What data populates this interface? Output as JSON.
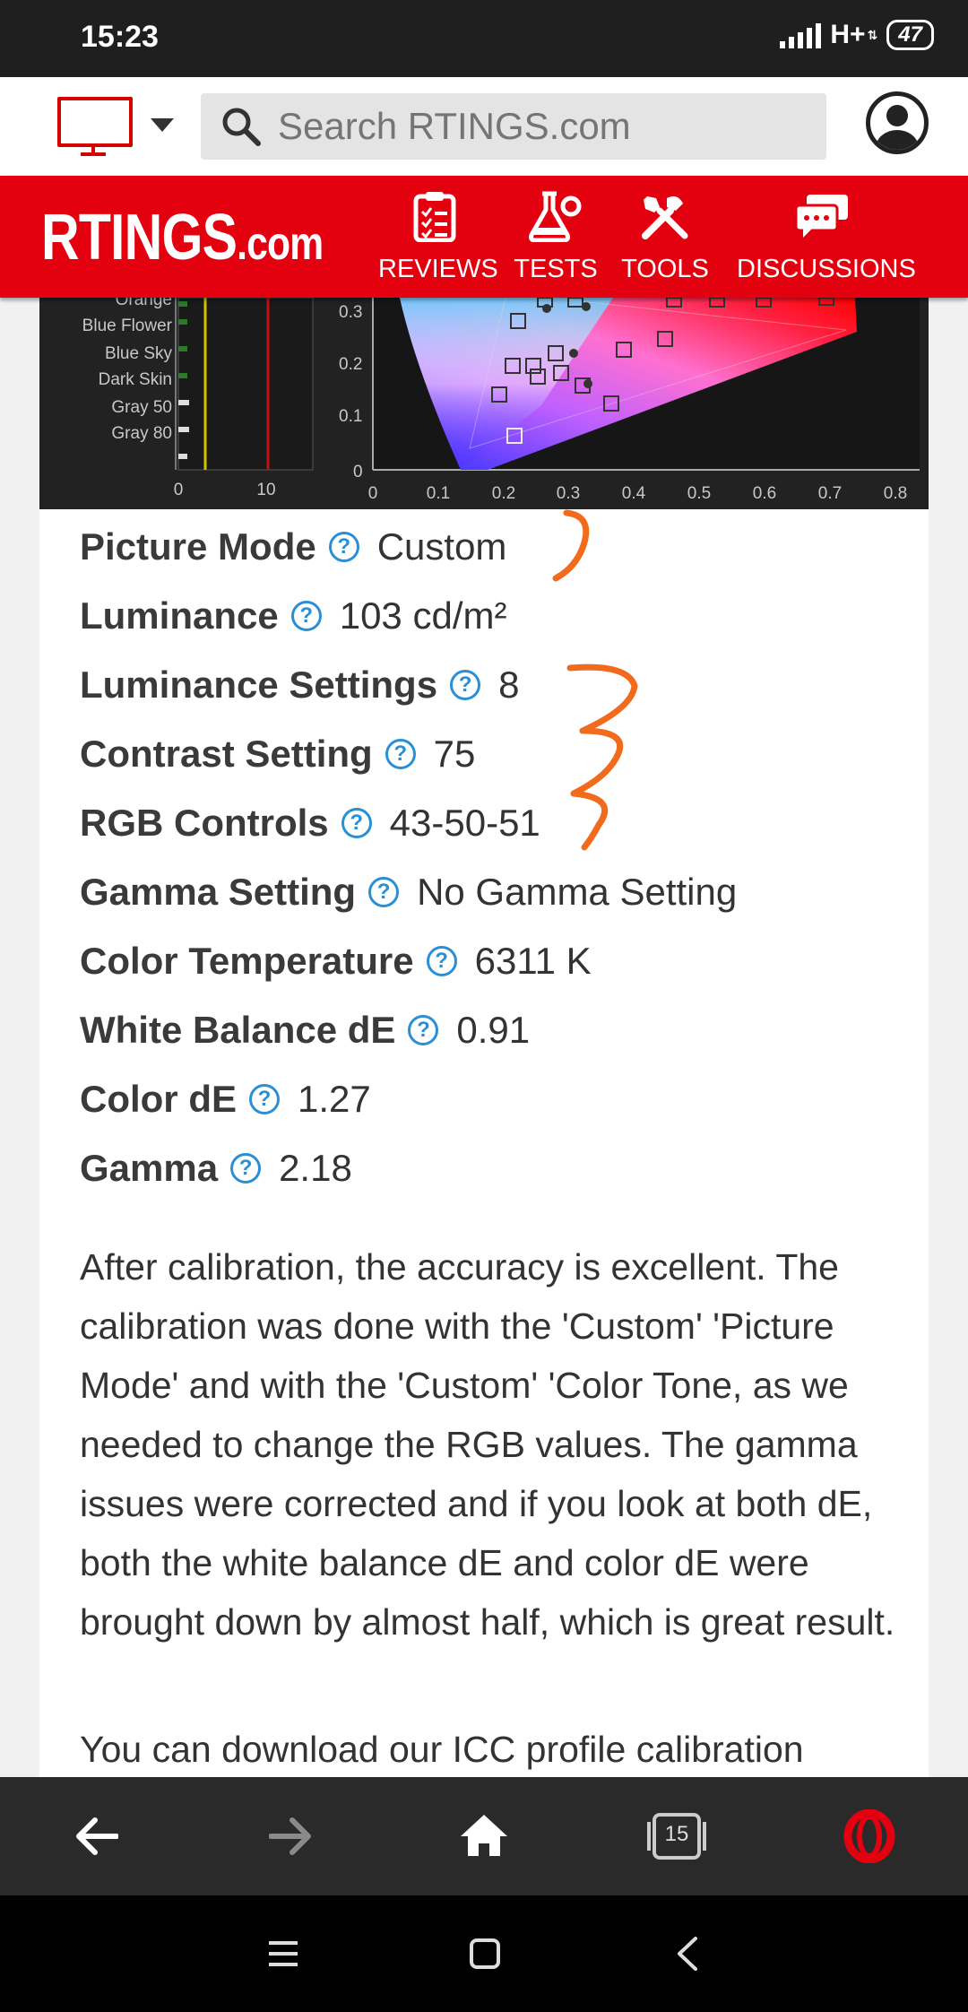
{
  "status": {
    "time": "15:23",
    "network": "H+",
    "battery": "47"
  },
  "search": {
    "placeholder": "Search RTINGS.com"
  },
  "header": {
    "logo_main": "RTINGS",
    "logo_suffix": ".com",
    "nav": [
      {
        "label": "REVIEWS",
        "icon": "clipboard-icon"
      },
      {
        "label": "TESTS",
        "icon": "flask-icon"
      },
      {
        "label": "TOOLS",
        "icon": "tools-icon"
      },
      {
        "label": "DISCUSSIONS",
        "icon": "chat-icon"
      }
    ]
  },
  "chart_left": {
    "labels": [
      "Orange",
      "Blue Flower",
      "Blue Sky",
      "Dark Skin",
      "Gray 50",
      "Gray 80"
    ],
    "xticks": [
      "0",
      "10"
    ]
  },
  "chart_right": {
    "yticks": [
      "0.3",
      "0.2",
      "0.1",
      "0"
    ],
    "xticks": [
      "0",
      "0.1",
      "0.2",
      "0.3",
      "0.4",
      "0.5",
      "0.6",
      "0.7",
      "0.8"
    ]
  },
  "specs": [
    {
      "label": "Picture Mode",
      "value": "Custom"
    },
    {
      "label": "Luminance",
      "value": "103 cd/m²"
    },
    {
      "label": "Luminance Settings",
      "value": "8"
    },
    {
      "label": "Contrast Setting",
      "value": "75"
    },
    {
      "label": "RGB Controls",
      "value": "43-50-51"
    },
    {
      "label": "Gamma Setting",
      "value": "No Gamma Setting"
    },
    {
      "label": "Color Temperature",
      "value": "6311 K"
    },
    {
      "label": "White Balance dE",
      "value": "0.91"
    },
    {
      "label": "Color dE",
      "value": "1.27"
    },
    {
      "label": "Gamma",
      "value": "2.18"
    }
  ],
  "help_glyph": "?",
  "paragraph": "After calibration, the accuracy is excellent. The calibration was done with the 'Custom' 'Picture Mode' and with the 'Custom' 'Color Tone, as we needed to change the RGB values. The gamma issues were corrected and if you look at both dE, both the white balance dE and color dE were brought down by almost half, which is great result.",
  "paragraph2_partial": "You can download our ICC profile calibration",
  "browser": {
    "tabs_count": "15"
  },
  "colors": {
    "brand_red": "#e3000f",
    "help_blue": "#2b8fd6",
    "annotation_orange": "#f26a1b"
  }
}
